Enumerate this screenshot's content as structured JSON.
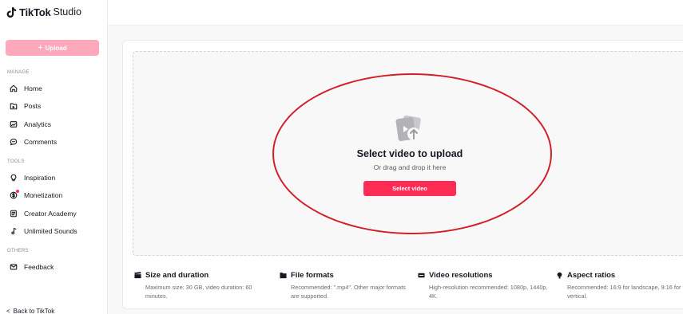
{
  "app": {
    "brand": "TikTok",
    "product": "Studio"
  },
  "sidebar": {
    "upload_label": "Upload",
    "sections": {
      "manage": "MANAGE",
      "tools": "TOOLS",
      "others": "OTHERS"
    },
    "items": [
      {
        "label": "Home",
        "icon": "home-icon"
      },
      {
        "label": "Posts",
        "icon": "folder-icon"
      },
      {
        "label": "Analytics",
        "icon": "analytics-icon"
      },
      {
        "label": "Comments",
        "icon": "comment-icon"
      },
      {
        "label": "Inspiration",
        "icon": "lightbulb-icon"
      },
      {
        "label": "Monetization",
        "icon": "dollar-icon"
      },
      {
        "label": "Creator Academy",
        "icon": "book-icon"
      },
      {
        "label": "Unlimited Sounds",
        "icon": "music-note-icon"
      },
      {
        "label": "Feedback",
        "icon": "mail-icon"
      }
    ],
    "back_label": "Back to TikTok"
  },
  "dropzone": {
    "title": "Select video to upload",
    "subtitle": "Or drag and drop it here",
    "button_label": "Select video"
  },
  "info": [
    {
      "title": "Size and duration",
      "desc": "Maximum size: 30 GB, video duration: 60 minutes.",
      "icon": "clapper-icon"
    },
    {
      "title": "File formats",
      "desc": "Recommended: \".mp4\". Other major formats are supported.",
      "icon": "file-icon"
    },
    {
      "title": "Video resolutions",
      "desc": "High-resolution recommended: 1080p, 1440p, 4K.",
      "icon": "hd-icon"
    },
    {
      "title": "Aspect ratios",
      "desc": "Recommended: 16:9 for landscape, 9:16 for vertical.",
      "icon": "ratio-icon"
    }
  ],
  "colors": {
    "accent": "#fe2c55",
    "upload_button_disabled": "#fea8bb",
    "annotation": "#d12028"
  }
}
